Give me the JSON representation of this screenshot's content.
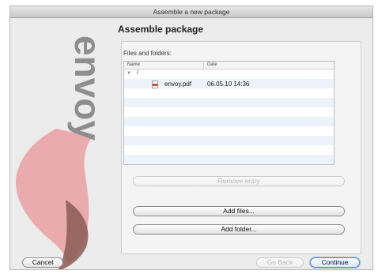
{
  "window": {
    "title": "Assemble a new package"
  },
  "brand": {
    "logo_text": "envoy"
  },
  "page": {
    "heading": "Assemble package"
  },
  "files": {
    "label": "Files and folders:",
    "columns": [
      "Name",
      "Date"
    ],
    "root": "/",
    "items": [
      {
        "name": "envoy.pdf",
        "date": "06.05.10 14:36",
        "icon": "pdf-icon"
      }
    ]
  },
  "buttons": {
    "remove": "Remove entry",
    "add_files": "Add files...",
    "add_folder": "Add folder...",
    "cancel": "Cancel",
    "go_back": "Go Back",
    "continue": "Continue"
  },
  "colors": {
    "brand_pink": "#e48a89",
    "brand_dark": "#8a5a55",
    "accent": "#5a86c8"
  }
}
